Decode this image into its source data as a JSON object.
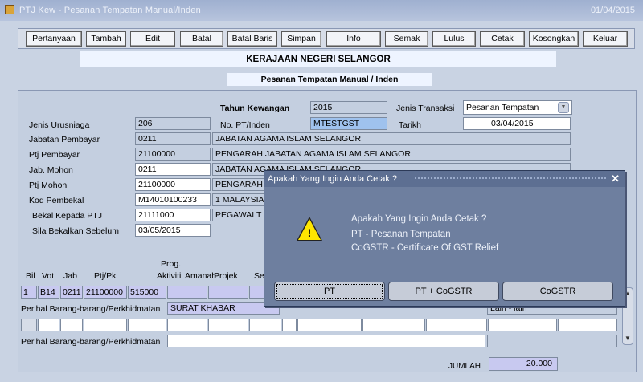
{
  "window": {
    "title": "PTJ Kew - Pesanan Tempatan Manual/Inden",
    "date": "01/04/2015"
  },
  "toolbar": [
    "Pertanyaan",
    "Tambah",
    "Edit",
    "Batal",
    "Batal Baris",
    "Simpan",
    "Info",
    "Semak",
    "Lulus",
    "Cetak",
    "Kosongkan",
    "Keluar"
  ],
  "banner": {
    "org": "KERAJAAN NEGERI SELANGOR",
    "form": "Pesanan Tempatan Manual / Inden"
  },
  "form": {
    "tahun_label": "Tahun Kewangan",
    "tahun_value": "2015",
    "jenis_transaksi_label": "Jenis Transaksi",
    "jenis_transaksi_value": "Pesanan Tempatan",
    "jenis_urusniaga_label": "Jenis Urusniaga",
    "jenis_urusniaga_value": "206",
    "no_pt_label": "No. PT/Inden",
    "no_pt_value": "MTESTGST",
    "tarikh_label": "Tarikh",
    "tarikh_value": "03/04/2015",
    "jabatan_pembayar_label": "Jabatan Pembayar",
    "jabatan_pembayar_code": "0211",
    "jabatan_pembayar_name": "JABATAN AGAMA ISLAM SELANGOR",
    "ptj_pembayar_label": "Ptj Pembayar",
    "ptj_pembayar_code": "21100000",
    "ptj_pembayar_name": "PENGARAH JABATAN AGAMA ISLAM SELANGOR",
    "jab_mohon_label": "Jab. Mohon",
    "jab_mohon_code": "0211",
    "jab_mohon_name": "JABATAN AGAMA ISLAM SELANGOR",
    "ptj_mohon_label": "Ptj Mohon",
    "ptj_mohon_code": "21100000",
    "ptj_mohon_name": "PENGARAH",
    "kod_pembekal_label": "Kod Pembekal",
    "kod_pembekal_code": "M14010100233",
    "kod_pembekal_name": "1 MALAYSIA",
    "bekal_label": "Bekal Kepada PTJ",
    "bekal_code": "21111000",
    "bekal_name": "PEGAWAI T",
    "sila_label": "Sila Bekalkan Sebelum",
    "sila_value": "03/05/2015"
  },
  "grid": {
    "headers": [
      "Bil",
      "Vot",
      "Jab",
      "Ptj/Pk",
      "Prog.",
      "Aktiviti",
      "Amanah",
      "Projek",
      "Se"
    ],
    "row1": [
      "1",
      "B14",
      "0211",
      "21100000",
      "515000"
    ],
    "perihal_label": "Perihal Barang-barang/Perkhidmatan",
    "perihal1_value": "SURAT KHABAR",
    "lain_value": "Lain - lain",
    "jumlah_label": "JUMLAH",
    "jumlah_value": "20.000"
  },
  "dialog": {
    "title": "Apakah Yang Ingin Anda Cetak ?",
    "line1": "Apakah Yang Ingin Anda Cetak ?",
    "line2": "PT - Pesanan Tempatan",
    "line3": "CoGSTR - Certificate Of GST Relief",
    "btn_pt": "PT",
    "btn_pt_cogstr": "PT + CoGSTR",
    "btn_cogstr": "CoGSTR"
  }
}
